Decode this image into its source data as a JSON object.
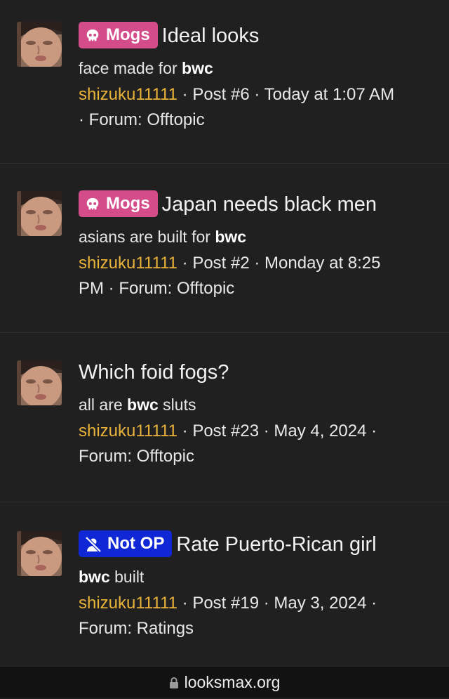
{
  "results": [
    {
      "badge": {
        "label": "Mogs",
        "icon": "skull-icon",
        "color": "#d44d8a"
      },
      "title": "Ideal looks",
      "snippet": {
        "before": "face made for ",
        "bold": "bwc",
        "after": ""
      },
      "author": "shizuku11111",
      "meta_line1": " · Post #6 · Today at 1:07 AM",
      "meta_line2": "· Forum: Offtopic"
    },
    {
      "badge": {
        "label": "Mogs",
        "icon": "skull-icon",
        "color": "#d44d8a"
      },
      "title": "Japan needs black men",
      "snippet": {
        "before": "asians are built for ",
        "bold": "bwc",
        "after": ""
      },
      "author": "shizuku11111",
      "meta_line1": " · Post #2 · Monday at 8:25",
      "meta_line2": "PM · Forum: Offtopic"
    },
    {
      "badge": null,
      "title": "Which foid fogs?",
      "snippet": {
        "before": "all are ",
        "bold": "bwc",
        "after": " sluts"
      },
      "author": "shizuku11111",
      "meta_line1": " · Post #23 · May 4, 2024 ·",
      "meta_line2": "Forum: Offtopic"
    },
    {
      "badge": {
        "label": "Not OP",
        "icon": "no-user-icon",
        "color": "#1027d6"
      },
      "title": "Rate Puerto-Rican girl",
      "snippet": {
        "before": "",
        "bold": "bwc",
        "after": " built"
      },
      "author": "shizuku11111",
      "meta_line1": " · Post #19 · May 3, 2024 ·",
      "meta_line2": "Forum: Ratings"
    }
  ],
  "browser": {
    "url": "looksmax.org",
    "icon": "lock-icon"
  },
  "colors": {
    "background": "#202020",
    "username": "#e8b23a",
    "mogs_badge": "#d44d8a",
    "notop_badge": "#1027d6"
  }
}
